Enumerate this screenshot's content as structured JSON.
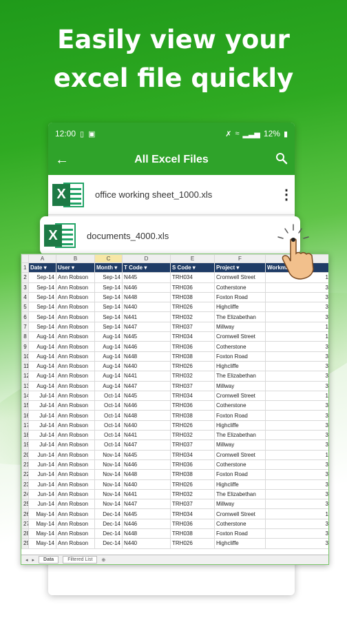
{
  "headline": {
    "line1": "Easily view your",
    "line2": "excel file quickly"
  },
  "status_bar": {
    "time": "12:00",
    "battery": "12%"
  },
  "app_bar": {
    "title": "All Excel Files",
    "back_icon": "arrow-back-icon",
    "search_icon": "search-icon"
  },
  "files": [
    {
      "name": "office working sheet_1000.xls"
    },
    {
      "name": "documents_4000.xls"
    }
  ],
  "sheet": {
    "column_letters": [
      "A",
      "B",
      "C",
      "D",
      "E",
      "F",
      "G"
    ],
    "headers": [
      "Date",
      "User",
      "Month",
      "T Code",
      "S Code",
      "Project",
      "Workmanship"
    ],
    "rows": [
      [
        "2",
        "Sep-14",
        "Ann Robson",
        "Sep-14",
        "N445",
        "TRH034",
        "Cromwell Street",
        "1"
      ],
      [
        "3",
        "Sep-14",
        "Ann Robson",
        "Sep-14",
        "N446",
        "TRH036",
        "Cotherstone",
        "3"
      ],
      [
        "4",
        "Sep-14",
        "Ann Robson",
        "Sep-14",
        "N448",
        "TRH038",
        "Foxton Road",
        "3"
      ],
      [
        "5",
        "Sep-14",
        "Ann Robson",
        "Sep-14",
        "N440",
        "TRH026",
        "Highcliffe",
        "3"
      ],
      [
        "6",
        "Sep-14",
        "Ann Robson",
        "Sep-14",
        "N441",
        "TRH032",
        "The Elizabethan",
        "3"
      ],
      [
        "7",
        "Sep-14",
        "Ann Robson",
        "Sep-14",
        "N447",
        "TRH037",
        "Millway",
        "1"
      ],
      [
        "8",
        "Aug-14",
        "Ann Robson",
        "Aug-14",
        "N445",
        "TRH034",
        "Cromwell Street",
        "1"
      ],
      [
        "9",
        "Aug-14",
        "Ann Robson",
        "Aug-14",
        "N446",
        "TRH036",
        "Cotherstone",
        "3"
      ],
      [
        "10",
        "Aug-14",
        "Ann Robson",
        "Aug-14",
        "N448",
        "TRH038",
        "Foxton Road",
        "3"
      ],
      [
        "11",
        "Aug-14",
        "Ann Robson",
        "Aug-14",
        "N440",
        "TRH026",
        "Highcliffe",
        "3"
      ],
      [
        "12",
        "Aug-14",
        "Ann Robson",
        "Aug-14",
        "N441",
        "TRH032",
        "The Elizabethan",
        "3"
      ],
      [
        "13",
        "Aug-14",
        "Ann Robson",
        "Aug-14",
        "N447",
        "TRH037",
        "Millway",
        "3"
      ],
      [
        "14",
        "Jul-14",
        "Ann Robson",
        "Oct-14",
        "N445",
        "TRH034",
        "Cromwell Street",
        "1"
      ],
      [
        "15",
        "Jul-14",
        "Ann Robson",
        "Oct-14",
        "N446",
        "TRH036",
        "Cotherstone",
        "3"
      ],
      [
        "16",
        "Jul-14",
        "Ann Robson",
        "Oct-14",
        "N448",
        "TRH038",
        "Foxton Road",
        "3"
      ],
      [
        "17",
        "Jul-14",
        "Ann Robson",
        "Oct-14",
        "N440",
        "TRH026",
        "Highcliffe",
        "3"
      ],
      [
        "18",
        "Jul-14",
        "Ann Robson",
        "Oct-14",
        "N441",
        "TRH032",
        "The Elizabethan",
        "3"
      ],
      [
        "19",
        "Jul-14",
        "Ann Robson",
        "Oct-14",
        "N447",
        "TRH037",
        "Millway",
        "3"
      ],
      [
        "20",
        "Jun-14",
        "Ann Robson",
        "Nov-14",
        "N445",
        "TRH034",
        "Cromwell Street",
        "1"
      ],
      [
        "21",
        "Jun-14",
        "Ann Robson",
        "Nov-14",
        "N446",
        "TRH036",
        "Cotherstone",
        "3"
      ],
      [
        "22",
        "Jun-14",
        "Ann Robson",
        "Nov-14",
        "N448",
        "TRH038",
        "Foxton Road",
        "3"
      ],
      [
        "23",
        "Jun-14",
        "Ann Robson",
        "Nov-14",
        "N440",
        "TRH026",
        "Highcliffe",
        "3"
      ],
      [
        "24",
        "Jun-14",
        "Ann Robson",
        "Nov-14",
        "N441",
        "TRH032",
        "The Elizabethan",
        "3"
      ],
      [
        "25",
        "Jun-14",
        "Ann Robson",
        "Nov-14",
        "N447",
        "TRH037",
        "Millway",
        "3"
      ],
      [
        "26",
        "May-14",
        "Ann Robson",
        "Dec-14",
        "N445",
        "TRH034",
        "Cromwell Street",
        "1"
      ],
      [
        "27",
        "May-14",
        "Ann Robson",
        "Dec-14",
        "N446",
        "TRH036",
        "Cotherstone",
        "3"
      ],
      [
        "28",
        "May-14",
        "Ann Robson",
        "Dec-14",
        "N448",
        "TRH038",
        "Foxton Road",
        "3"
      ],
      [
        "29",
        "May-14",
        "Ann Robson",
        "Dec-14",
        "N440",
        "TRH026",
        "Highcliffe",
        "3"
      ]
    ],
    "tabs": [
      "Data",
      "Filtered List"
    ]
  },
  "colors": {
    "brand_green": "#2fa32a",
    "header_navy": "#1f3c66",
    "excel_green": "#1d7a45"
  }
}
